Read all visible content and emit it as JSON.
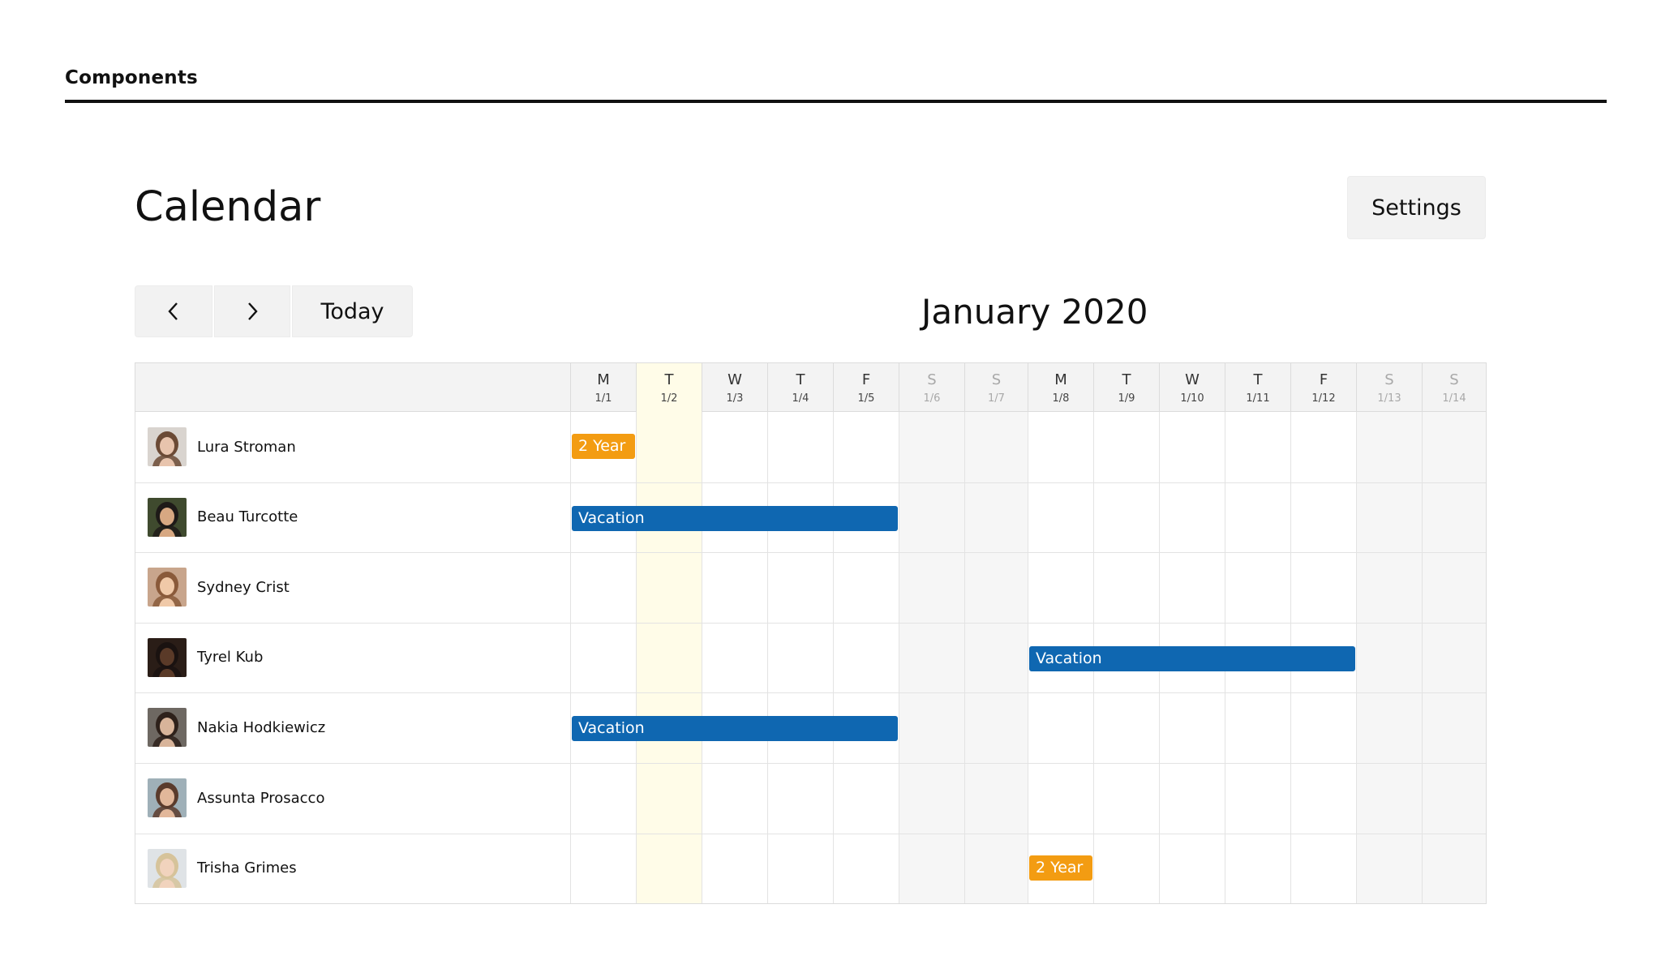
{
  "section": {
    "title": "Components"
  },
  "page": {
    "title": "Calendar"
  },
  "settings_label": "Settings",
  "nav": {
    "prev_icon": "chevron-left-icon",
    "next_icon": "chevron-right-icon",
    "today_label": "Today"
  },
  "month_label": "January 2020",
  "days": [
    {
      "letter": "M",
      "date": "1/1",
      "weekend": false,
      "today": false
    },
    {
      "letter": "T",
      "date": "1/2",
      "weekend": false,
      "today": true
    },
    {
      "letter": "W",
      "date": "1/3",
      "weekend": false,
      "today": false
    },
    {
      "letter": "T",
      "date": "1/4",
      "weekend": false,
      "today": false
    },
    {
      "letter": "F",
      "date": "1/5",
      "weekend": false,
      "today": false
    },
    {
      "letter": "S",
      "date": "1/6",
      "weekend": true,
      "today": false
    },
    {
      "letter": "S",
      "date": "1/7",
      "weekend": true,
      "today": false
    },
    {
      "letter": "M",
      "date": "1/8",
      "weekend": false,
      "today": false
    },
    {
      "letter": "T",
      "date": "1/9",
      "weekend": false,
      "today": false
    },
    {
      "letter": "W",
      "date": "1/10",
      "weekend": false,
      "today": false
    },
    {
      "letter": "T",
      "date": "1/11",
      "weekend": false,
      "today": false
    },
    {
      "letter": "F",
      "date": "1/12",
      "weekend": false,
      "today": false
    },
    {
      "letter": "S",
      "date": "1/13",
      "weekend": true,
      "today": false
    },
    {
      "letter": "S",
      "date": "1/14",
      "weekend": true,
      "today": false
    }
  ],
  "people": [
    {
      "name": "Lura Stroman",
      "avatar": "woman-portrait-avatar",
      "skin": "#e8c4ad",
      "hair": "#6b4a35",
      "bg": "#d9d4cf"
    },
    {
      "name": "Beau Turcotte",
      "avatar": "man-portrait-avatar",
      "skin": "#d7a882",
      "hair": "#1e1a18",
      "bg": "#3f4a2e"
    },
    {
      "name": "Sydney Crist",
      "avatar": "woman-portrait-avatar",
      "skin": "#f0c9a8",
      "hair": "#8a5a3a",
      "bg": "#c8a58c"
    },
    {
      "name": "Tyrel Kub",
      "avatar": "man-portrait-avatar",
      "skin": "#5a3a28",
      "hair": "#1a1210",
      "bg": "#2a1d17"
    },
    {
      "name": "Nakia Hodkiewicz",
      "avatar": "woman-portrait-avatar",
      "skin": "#d8b49a",
      "hair": "#2e211b",
      "bg": "#6e6862"
    },
    {
      "name": "Assunta Prosacco",
      "avatar": "woman-portrait-avatar",
      "skin": "#e2b79a",
      "hair": "#5a3b2c",
      "bg": "#9fb0b8"
    },
    {
      "name": "Trisha Grimes",
      "avatar": "woman-portrait-avatar",
      "skin": "#f1d3bd",
      "hair": "#d6c39a",
      "bg": "#dfe3e6"
    }
  ],
  "events": [
    {
      "row": 0,
      "start": 0,
      "end": 0,
      "label": "2 Year",
      "type": "anniversary"
    },
    {
      "row": 1,
      "start": 0,
      "end": 4,
      "label": "Vacation",
      "type": "vacation"
    },
    {
      "row": 3,
      "start": 7,
      "end": 11,
      "label": "Vacation",
      "type": "vacation"
    },
    {
      "row": 4,
      "start": 0,
      "end": 4,
      "label": "Vacation",
      "type": "vacation"
    },
    {
      "row": 6,
      "start": 7,
      "end": 7,
      "label": "2 Year",
      "type": "anniversary"
    }
  ],
  "colors": {
    "vacation": "#0f67b1",
    "anniversary": "#f39c12",
    "today_column": "#fffce8",
    "weekend_column": "#f6f6f6",
    "header_bg": "#f3f3f3"
  }
}
